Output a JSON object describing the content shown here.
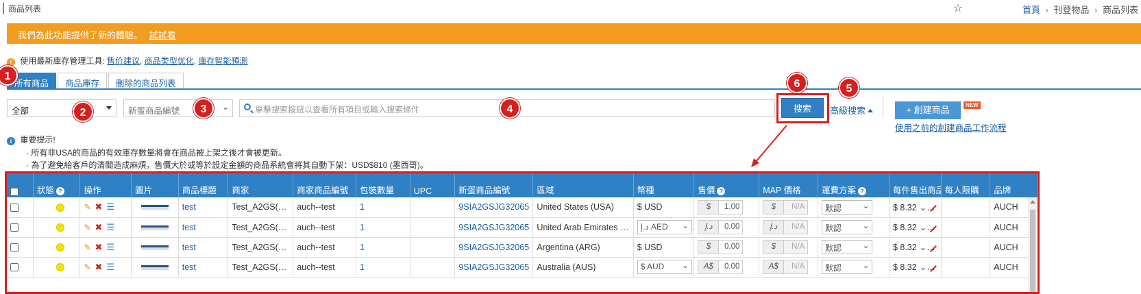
{
  "header": {
    "page_title": "商品列表",
    "breadcrumb": [
      "首頁",
      "刊登物品",
      "商品列表"
    ],
    "breadcrumb_sep": "›"
  },
  "banner": {
    "text": "我們為此功能提供了新的體驗。",
    "link": "試試看"
  },
  "tools": {
    "label": "使用最新庫存管理工具:",
    "links": [
      "售价建议",
      "商品类型优化",
      "庫存智能預測"
    ]
  },
  "tabs": [
    {
      "label": "所有商品",
      "active": true
    },
    {
      "label": "商品庫存",
      "active": false
    },
    {
      "label": "刪除的商品列表",
      "active": false
    }
  ],
  "filters": {
    "scope_value": "全部",
    "field_value": "新蛋商品編號",
    "search_placeholder": "單擊搜索按鈕以查看所有項目或輸入搜索條件",
    "search_button": "搜索",
    "advanced_search": "高級搜索",
    "create_button": "+ 創建商品",
    "new_badge": "NEW",
    "prev_flow_link": "使用之前的創建商品工作流程"
  },
  "notice": {
    "title": "重要提示!",
    "lines": [
      "· 所有非USA的商品的有效庫存數量將會在商品被上架之後才會被更新。",
      "· 為了避免給客戶的清關造成麻煩，售價大於或等於設定金額的商品系統會將其自動下架：USD$810 (墨西哥)。"
    ]
  },
  "markers": [
    "1",
    "2",
    "3",
    "4",
    "5",
    "6"
  ],
  "table": {
    "columns": [
      "狀態",
      "操作",
      "圖片",
      "商品標題",
      "商家",
      "商家商品編號",
      "包裝數量",
      "UPC",
      "新蛋商品編號",
      "區域",
      "幣種",
      "售價",
      "MAP 價格",
      "運費方案",
      "每件售出商品的...",
      "每人限購",
      "品牌"
    ],
    "rows": [
      {
        "title": "test",
        "seller": "Test_A2GS(A...",
        "seller_sku": "auch--test",
        "pack": "1",
        "upc": "",
        "newegg_id": "9SIA2GSJG32065",
        "region": "United States (USA)",
        "currency": "$ USD",
        "currency_select": false,
        "price_symbol": "$",
        "price": "1.00",
        "map_symbol": "$",
        "map": "N/A",
        "shipping": "默認",
        "fee": "$ 8.32",
        "limit": "",
        "brand": "AUCH"
      },
      {
        "title": "test",
        "seller": "Test_A2GS(A...",
        "seller_sku": "auch--test",
        "pack": "1",
        "upc": "",
        "newegg_id": "9SIA2GSJG32065",
        "region": "United Arab Emirates (...",
        "currency": "د.إ AED",
        "currency_select": true,
        "price_symbol": "د.إ",
        "price": "0.00",
        "map_symbol": "د.إ",
        "map": "N/A",
        "shipping": "默認",
        "fee": "$ 8.32",
        "limit": "",
        "brand": "AUCH"
      },
      {
        "title": "test",
        "seller": "Test_A2GS(A...",
        "seller_sku": "auch--test",
        "pack": "1",
        "upc": "",
        "newegg_id": "9SIA2GSJG32065",
        "region": "Argentina (ARG)",
        "currency": "$ USD",
        "currency_select": false,
        "price_symbol": "$",
        "price": "0.00",
        "map_symbol": "$",
        "map": "N/A",
        "shipping": "默認",
        "fee": "$ 8.32",
        "limit": "",
        "brand": "AUCH"
      },
      {
        "title": "test",
        "seller": "Test_A2GS(A...",
        "seller_sku": "auch--test",
        "pack": "1",
        "upc": "",
        "newegg_id": "9SIA2GSJG32065",
        "region": "Australia (AUS)",
        "currency": "$ AUD",
        "currency_select": true,
        "price_symbol": "A$",
        "price": "0.00",
        "map_symbol": "A$",
        "map": "N/A",
        "shipping": "默認",
        "fee": "$ 8.32",
        "limit": "",
        "brand": "AUCH"
      }
    ]
  },
  "colors": {
    "brand_blue": "#2f80c4",
    "banner_orange": "#f39c1f",
    "annotation_red": "#d61f1f"
  }
}
